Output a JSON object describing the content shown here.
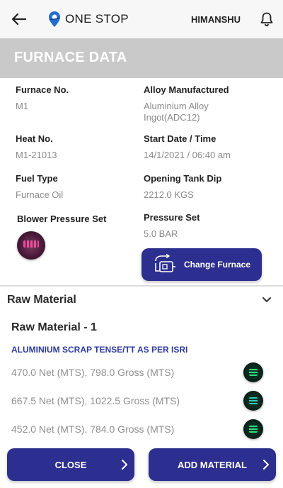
{
  "header": {
    "brand": "ONE STOP",
    "user": "HIMANSHU",
    "icons": {
      "back": "back-arrow-icon",
      "logo": "location-pin-logo-icon",
      "notifications": "bell-icon"
    }
  },
  "page": {
    "title": "FURNACE DATA"
  },
  "details": {
    "furnace_no": {
      "label": "Furnace No.",
      "value": "M1"
    },
    "alloy": {
      "label": "Alloy Manufactured",
      "value": "Aluminium Alloy Ingot(ADC12)"
    },
    "heat_no": {
      "label": "Heat No.",
      "value": "M1-21013"
    },
    "start": {
      "label": "Start Date / Time",
      "value": "14/1/2021 / 06:40 am"
    },
    "fuel": {
      "label": "Fuel Type",
      "value": "Furnace Oil"
    },
    "tank_dip": {
      "label": "Opening Tank Dip",
      "value": "2212.0 KGS"
    },
    "blower": {
      "label": "Blower Pressure Set"
    },
    "pressure": {
      "label": "Pressure Set",
      "value": "5.0 BAR"
    }
  },
  "buttons": {
    "change_furnace": "Change Furnace",
    "close": "CLOSE",
    "add_material": "ADD MATERIAL"
  },
  "raw_material": {
    "section_title": "Raw Material",
    "item_title": "Raw Material - 1",
    "material_name": "ALUMINIUM SCRAP TENSE/TT AS PER ISRI",
    "rows": [
      {
        "text": "470.0 Net (MTS),     798.0 Gross (MTS)"
      },
      {
        "text": "667.5 Net (MTS),     1022.5 Gross (MTS)"
      },
      {
        "text": "452.0 Net (MTS),     784.0 Gross (MTS)"
      }
    ]
  },
  "colors": {
    "primary": "#2c2f8f",
    "band": "#c9c9c9",
    "material_name": "#2c3a9c"
  }
}
